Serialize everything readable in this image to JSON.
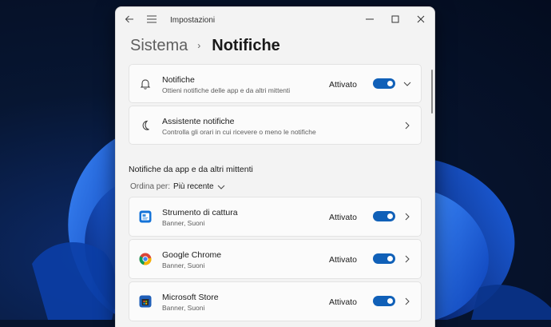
{
  "window": {
    "app_title": "Impostazioni"
  },
  "breadcrumb": {
    "parent": "Sistema",
    "separator": "›",
    "current": "Notifiche"
  },
  "notifications_card": {
    "title": "Notifiche",
    "subtitle": "Ottieni notifiche delle app e da altri mittenti",
    "state": "Attivato",
    "toggle_on": true,
    "icon": "bell-icon"
  },
  "assistant_card": {
    "title": "Assistente notifiche",
    "subtitle": "Controlla gli orari in cui ricevere o meno le notifiche",
    "icon": "moon-icon"
  },
  "senders_section": {
    "heading": "Notifiche da app e da altri mittenti",
    "sort_label": "Ordina per:",
    "sort_value": "Più recente"
  },
  "apps": [
    {
      "name": "Strumento di cattura",
      "detail": "Banner, Suoni",
      "state": "Attivato",
      "toggle_on": true,
      "icon": "snipping-tool-icon"
    },
    {
      "name": "Google Chrome",
      "detail": "Banner, Suoni",
      "state": "Attivato",
      "toggle_on": true,
      "icon": "chrome-icon"
    },
    {
      "name": "Microsoft Store",
      "detail": "Banner, Suoni",
      "state": "Attivato",
      "toggle_on": true,
      "icon": "store-icon"
    }
  ],
  "colors": {
    "accent": "#1060b8",
    "window_bg": "#f3f3f3",
    "card_bg": "#fbfbfb"
  }
}
